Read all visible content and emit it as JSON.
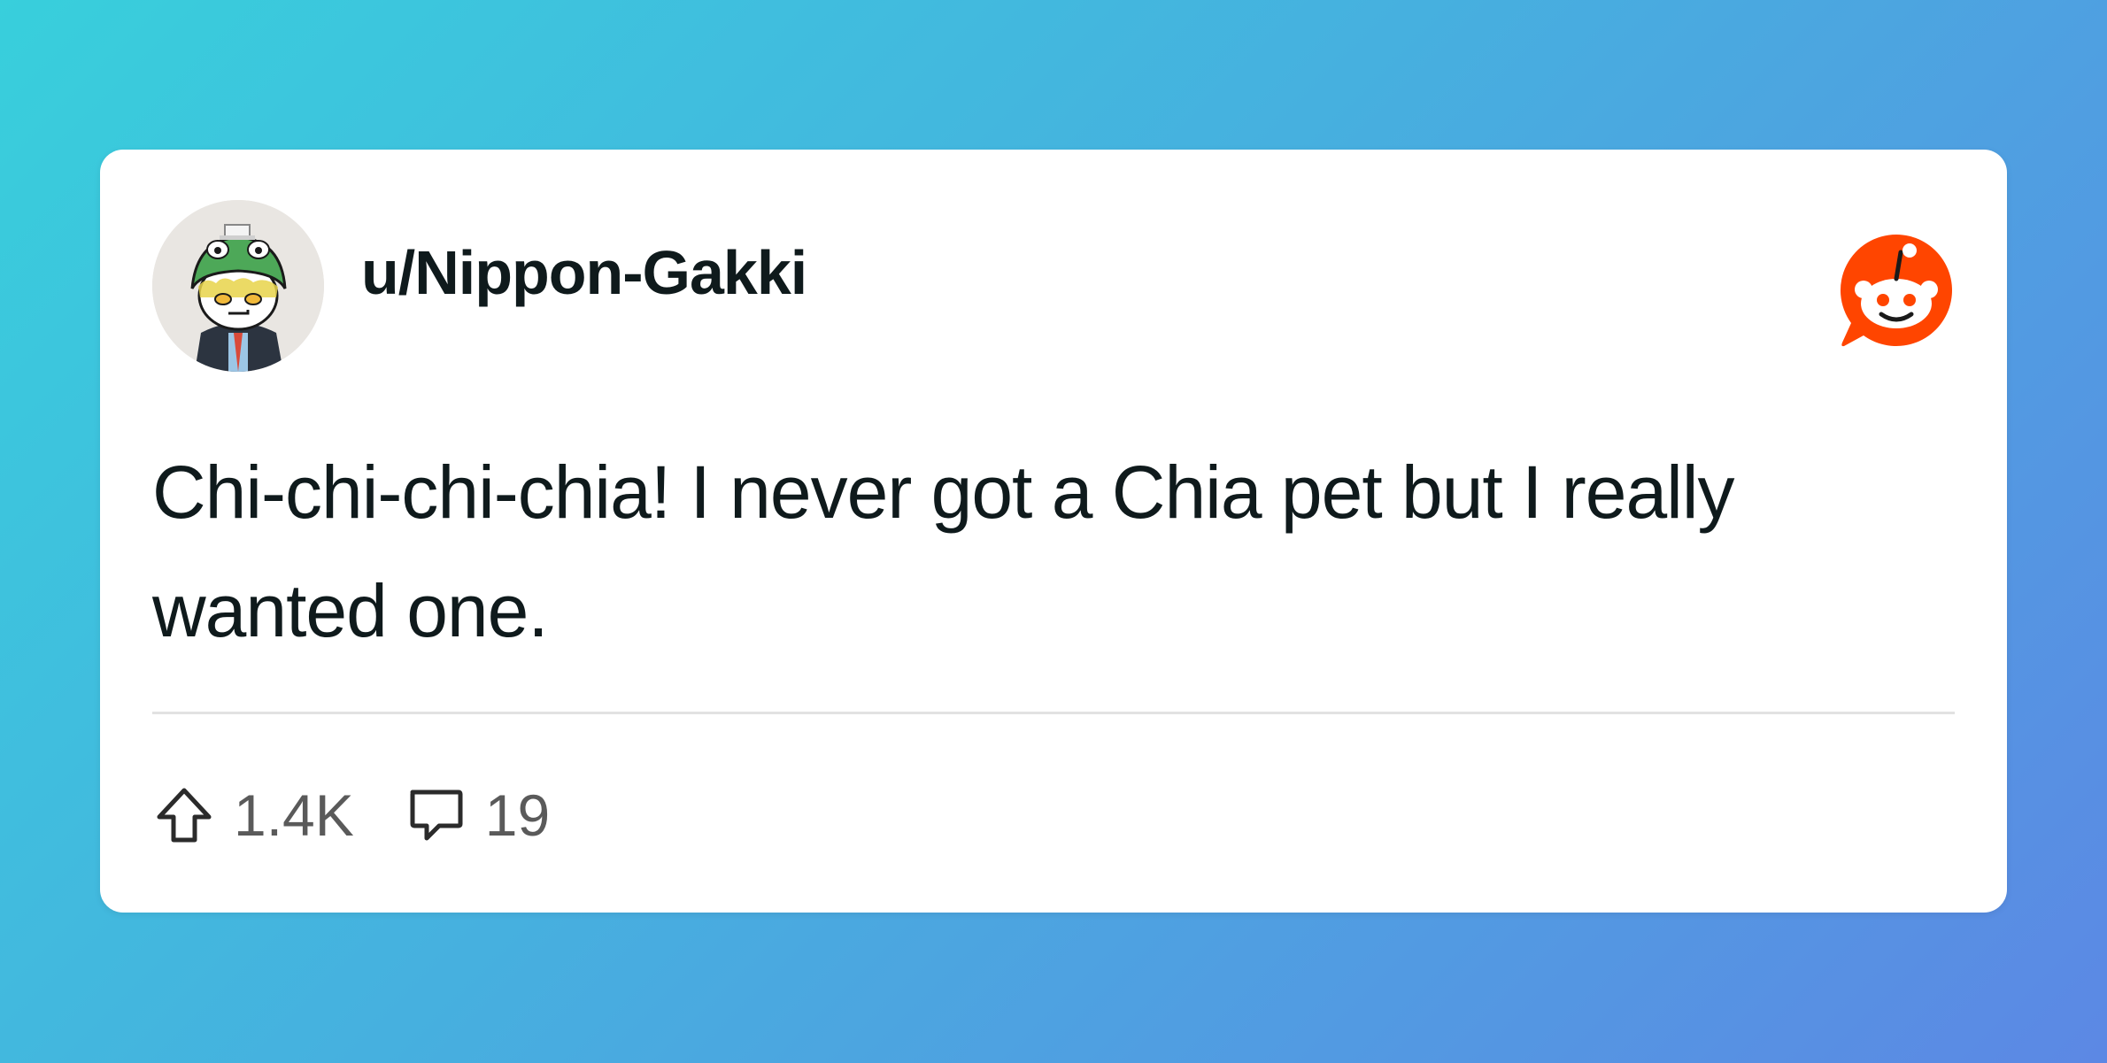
{
  "post": {
    "username": "u/Nippon-Gakki",
    "body": "Chi-chi-chi-chia! I never got a Chia pet but I really wanted one.",
    "upvotes": "1.4K",
    "comments": "19"
  },
  "icons": {
    "upvote": "arrow-up-icon",
    "comment": "speech-bubble-icon",
    "brand": "reddit-snoo-logo"
  },
  "colors": {
    "brand": "#ff4500",
    "text": "#0f1a1c",
    "muted": "#5a5a5a"
  }
}
